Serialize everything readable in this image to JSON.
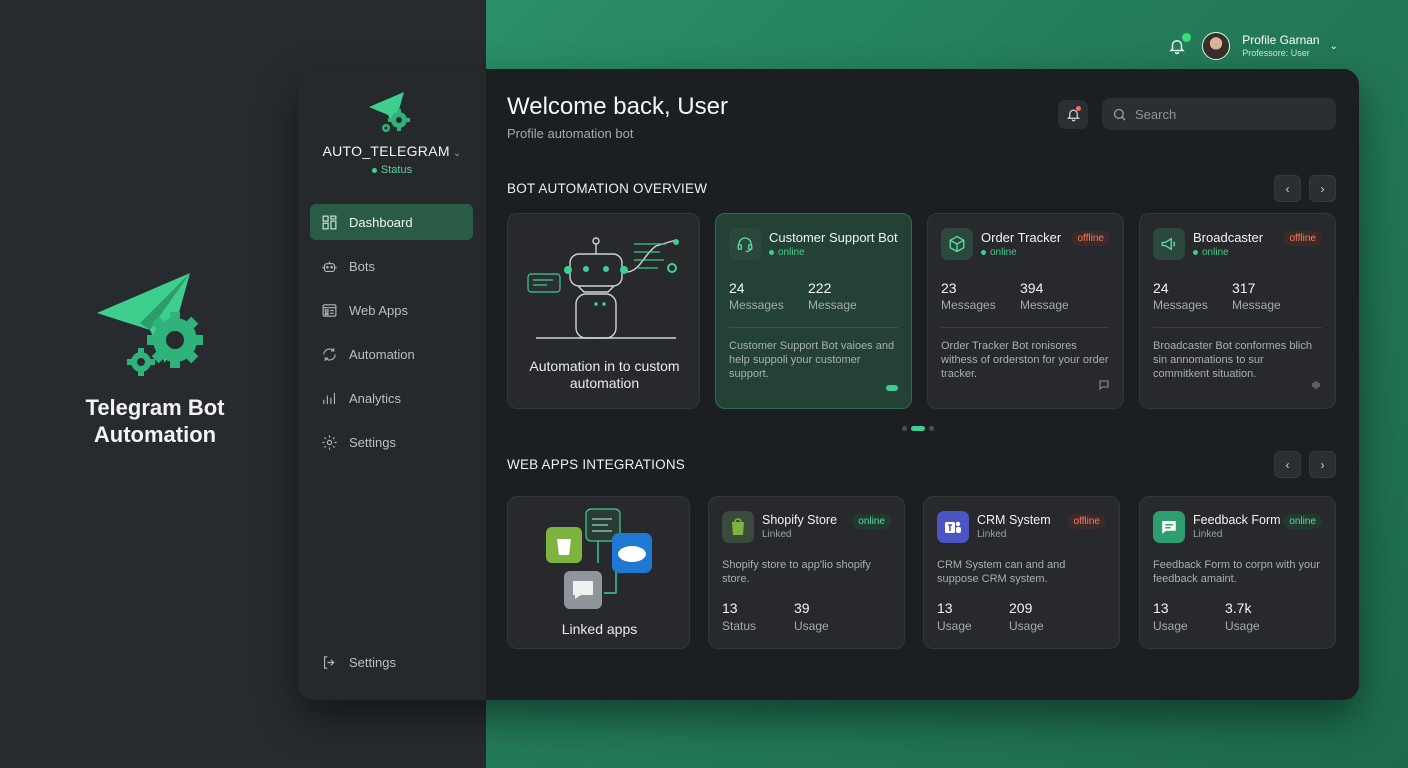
{
  "brand": {
    "title": "Telegram Bot Automation"
  },
  "topbar": {
    "notification_count": "1",
    "profile_name": "Profile Garnan",
    "profile_role": "Professore: User"
  },
  "sidebar": {
    "app_name": "AUTO_TELEGRAM",
    "status": "Status",
    "items": [
      {
        "label": "Dashboard",
        "icon": "dashboard-icon",
        "active": true
      },
      {
        "label": "Bots",
        "icon": "robot-icon"
      },
      {
        "label": "Web Apps",
        "icon": "web-apps-icon"
      },
      {
        "label": "Automation",
        "icon": "automation-icon"
      },
      {
        "label": "Analytics",
        "icon": "analytics-icon"
      },
      {
        "label": "Settings",
        "icon": "gear-icon"
      }
    ],
    "bottom_item": {
      "label": "Settings",
      "icon": "logout-icon"
    }
  },
  "header": {
    "title": "Welcome back, User",
    "subtitle": "Profile automation bot"
  },
  "search": {
    "placeholder": "Search"
  },
  "bot_overview": {
    "title": "BOT AUTOMATION OVERVIEW",
    "illustration_caption": "Automation in to custom automation",
    "bots": [
      {
        "name": "Customer Support Bot",
        "status": "online",
        "badge": "",
        "stat1_value": "24",
        "stat1_label": "Messages",
        "stat2_value": "222",
        "stat2_label": "Message",
        "description": "Customer Support Bot vaioes and help suppoli your customer support.",
        "footer_icon": "toggle-icon"
      },
      {
        "name": "Order Tracker",
        "status": "online",
        "badge": "offline",
        "stat1_value": "23",
        "stat1_label": "Messages",
        "stat2_value": "394",
        "stat2_label": "Message",
        "description": "Order Tracker Bot ronisores withess of orderston for your order tracker.",
        "footer_icon": "chat-icon"
      },
      {
        "name": "Broadcaster",
        "status": "online",
        "badge": "offline",
        "stat1_value": "24",
        "stat1_label": "Messages",
        "stat2_value": "317",
        "stat2_label": "Message",
        "description": "Broadcaster Bot conformes blich sin annomations to sur commitkent situation.",
        "footer_icon": "signal-icon"
      }
    ],
    "pager": {
      "current": 2,
      "total": 3
    }
  },
  "web_apps": {
    "title": "WEB APPS INTEGRATIONS",
    "linked_caption": "Linked apps",
    "apps": [
      {
        "name": "Shopify Store",
        "status": "Linked",
        "badge": "online",
        "description": "Shopify store to app'lio shopify store.",
        "stat1_value": "13",
        "stat1_label": "Status",
        "stat2_value": "39",
        "stat2_label": "Usage",
        "icon": "shopify-icon",
        "color": "#3c4a3e"
      },
      {
        "name": "CRM System",
        "status": "Linked",
        "badge": "offline",
        "description": "CRM System can and and suppose CRM system.",
        "stat1_value": "13",
        "stat1_label": "Usage",
        "stat2_value": "209",
        "stat2_label": "Usage",
        "icon": "teams-icon",
        "color": "#4b55c4"
      },
      {
        "name": "Feedback Form",
        "status": "Linked",
        "badge": "online",
        "description": "Feedback Form to corpn with your feedback amaint.",
        "stat1_value": "13",
        "stat1_label": "Usage",
        "stat2_value": "3.7k",
        "stat2_label": "Usage",
        "icon": "feedback-icon",
        "color": "#2f9e6e"
      }
    ]
  },
  "colors": {
    "accent": "#3ecf8e",
    "offline": "#ff7a62",
    "background": "#1c1f22"
  }
}
